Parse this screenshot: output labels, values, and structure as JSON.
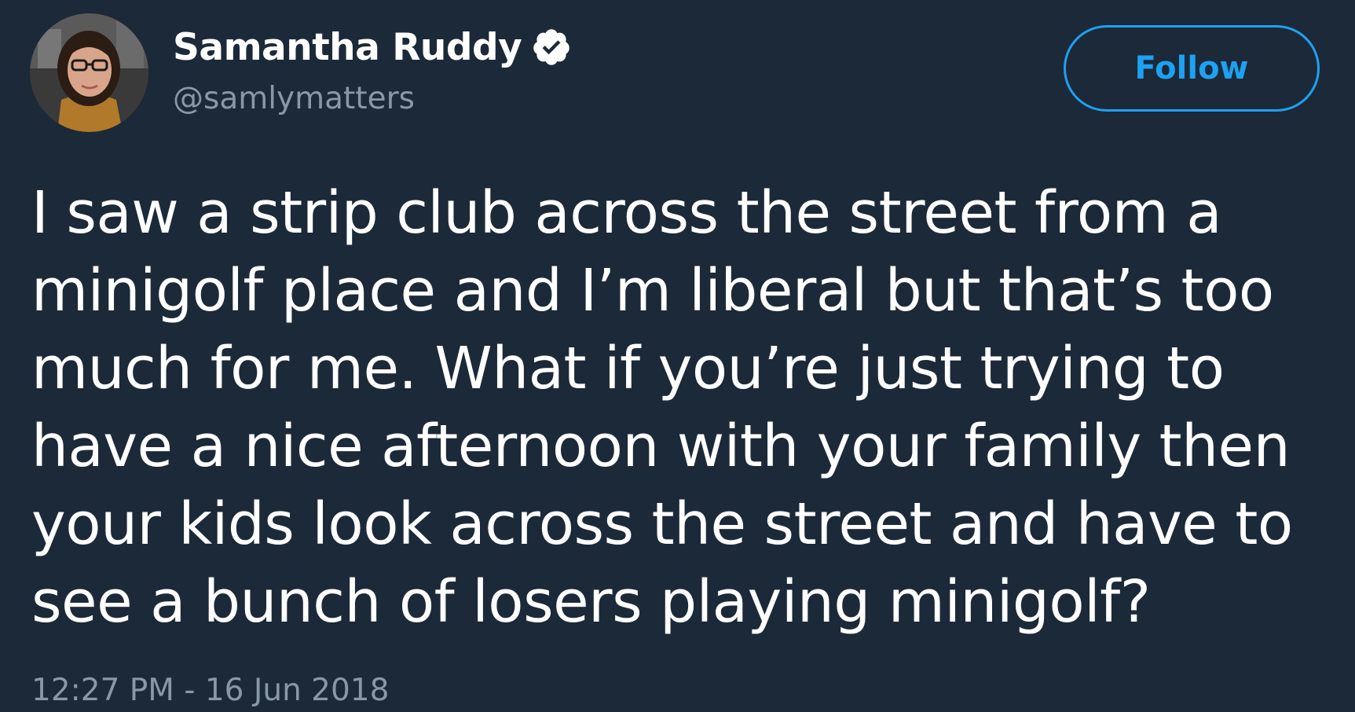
{
  "author": {
    "display_name": "Samantha Ruddy",
    "handle": "@samlymatters",
    "verified": true,
    "avatar_icon": "user-avatar-photo"
  },
  "follow_button": {
    "label": "Follow"
  },
  "tweet": {
    "text_lines": [
      "I saw a strip club across the street from a",
      "minigolf place and I’m liberal but that’s too",
      "much for me. What if you’re just trying to",
      "have a nice afternoon with your family then",
      "your kids look across the street and have to",
      "see a bunch of losers playing minigolf?"
    ],
    "timestamp": "12:27 PM - 16 Jun 2018"
  },
  "colors": {
    "background": "#1c2938",
    "text": "#ffffff",
    "secondary_text": "#8899a6",
    "accent": "#1da1f2"
  }
}
